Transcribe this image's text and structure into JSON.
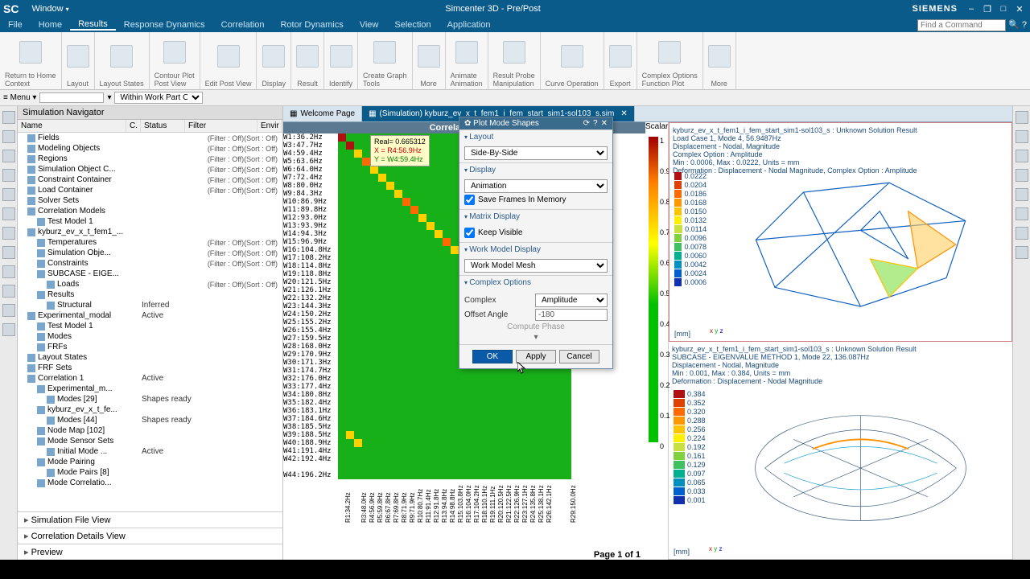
{
  "titlebar": {
    "app_short": "SC",
    "window_menu": "Window",
    "title": "Simcenter 3D - Pre/Post",
    "brand": "SIEMENS"
  },
  "menubar": {
    "items": [
      "File",
      "Home",
      "Results",
      "Response Dynamics",
      "Correlation",
      "Rotor Dynamics",
      "View",
      "Selection",
      "Application"
    ],
    "active_index": 2,
    "search_placeholder": "Find a Command"
  },
  "ribbon": {
    "groups": [
      {
        "label": "Return to Home",
        "sub": "Context"
      },
      {
        "label": "Layout"
      },
      {
        "label": "Layout States"
      },
      {
        "label": "Contour Plot",
        "sub": "Post View"
      },
      {
        "label": "Edit Post View"
      },
      {
        "label": "Display"
      },
      {
        "label": "Result"
      },
      {
        "label": "Identify"
      },
      {
        "label": "Create Graph",
        "sub": "Tools"
      },
      {
        "label": "More"
      },
      {
        "label": "Animate",
        "sub": "Animation"
      },
      {
        "label": "Result Probe",
        "sub": "Manipulation"
      },
      {
        "label": "Curve Operation"
      },
      {
        "label": "Export"
      },
      {
        "label": "Complex Options",
        "sub": "Function Plot"
      },
      {
        "label": "More"
      }
    ]
  },
  "context_row": {
    "menu_label": "Menu",
    "filter_label": "Within Work Part Only"
  },
  "nav": {
    "title": "Simulation Navigator",
    "cols": [
      "Name",
      "C.",
      "Status",
      "Filter",
      "Envir"
    ],
    "rows": [
      {
        "indent": 1,
        "name": "Fields",
        "filter": "(Filter : Off)(Sort : Off)"
      },
      {
        "indent": 1,
        "name": "Modeling Objects",
        "filter": "(Filter : Off)(Sort : Off)"
      },
      {
        "indent": 1,
        "name": "Regions",
        "filter": "(Filter : Off)(Sort : Off)"
      },
      {
        "indent": 1,
        "name": "Simulation Object C...",
        "filter": "(Filter : Off)(Sort : Off)"
      },
      {
        "indent": 1,
        "name": "Constraint Container",
        "filter": "(Filter : Off)(Sort : Off)"
      },
      {
        "indent": 1,
        "name": "Load Container",
        "filter": "(Filter : Off)(Sort : Off)"
      },
      {
        "indent": 1,
        "name": "Solver Sets"
      },
      {
        "indent": 1,
        "name": "Correlation Models"
      },
      {
        "indent": 2,
        "name": "Test Model 1"
      },
      {
        "indent": 1,
        "name": "kyburz_ev_x_t_fem1_..."
      },
      {
        "indent": 2,
        "name": "Temperatures",
        "filter": "(Filter : Off)(Sort : Off)"
      },
      {
        "indent": 2,
        "name": "Simulation Obje...",
        "filter": "(Filter : Off)(Sort : Off)"
      },
      {
        "indent": 2,
        "name": "Constraints",
        "filter": "(Filter : Off)(Sort : Off)"
      },
      {
        "indent": 2,
        "name": "SUBCASE - EIGE..."
      },
      {
        "indent": 3,
        "name": "Loads",
        "filter": "(Filter : Off)(Sort : Off)"
      },
      {
        "indent": 2,
        "name": "Results"
      },
      {
        "indent": 3,
        "name": "Structural",
        "status": "Inferred"
      },
      {
        "indent": 1,
        "name": "Experimental_modal",
        "status": "Active"
      },
      {
        "indent": 2,
        "name": "Test Model 1"
      },
      {
        "indent": 2,
        "name": "Modes"
      },
      {
        "indent": 2,
        "name": "FRFs"
      },
      {
        "indent": 1,
        "name": "Layout States"
      },
      {
        "indent": 1,
        "name": "FRF Sets"
      },
      {
        "indent": 1,
        "name": "Correlation 1",
        "status": "Active"
      },
      {
        "indent": 2,
        "name": "Experimental_m..."
      },
      {
        "indent": 3,
        "name": "Modes [29]",
        "status": "Shapes ready"
      },
      {
        "indent": 2,
        "name": "kyburz_ev_x_t_fe..."
      },
      {
        "indent": 3,
        "name": "Modes [44]",
        "status": "Shapes ready"
      },
      {
        "indent": 2,
        "name": "Node Map [102]"
      },
      {
        "indent": 2,
        "name": "Mode Sensor Sets"
      },
      {
        "indent": 3,
        "name": "Initial Mode ...",
        "status": "Active"
      },
      {
        "indent": 2,
        "name": "Mode Pairing"
      },
      {
        "indent": 3,
        "name": "Mode Pairs [8]"
      },
      {
        "indent": 2,
        "name": "Mode Correlatio..."
      }
    ],
    "accordions": [
      "Simulation File View",
      "Correlation Details View",
      "Preview"
    ]
  },
  "tabs": {
    "items": [
      {
        "label": "Welcome Page"
      },
      {
        "label": "(Simulation) kyburz_ev_x_t_fem1_i_fem_start_sim1-sol103_s.sim",
        "active": true
      }
    ]
  },
  "mac": {
    "title": "Correlation MAC",
    "tooltip": {
      "real": "Real= 0.665312",
      "x": "X   = R4:56.9Hz",
      "y": "Y   = W4:59.4Hz"
    },
    "row_labels": [
      "W1:36.2Hz",
      "W3:47.7Hz",
      "W4:59.4Hz",
      "W5:63.6Hz",
      "W6:64.0Hz",
      "W7:72.4Hz",
      "W8:80.0Hz",
      "W9:84.3Hz",
      "W10:86.9Hz",
      "W11:89.8Hz",
      "W12:93.0Hz",
      "W13:93.9Hz",
      "W14:94.3Hz",
      "W15:96.9Hz",
      "W16:104.8Hz",
      "W17:108.2Hz",
      "W18:114.8Hz",
      "W19:118.8Hz",
      "W20:121.5Hz",
      "W21:126.1Hz",
      "W22:132.2Hz",
      "W23:144.3Hz",
      "W24:150.2Hz",
      "W25:155.2Hz",
      "W26:155.4Hz",
      "W27:159.5Hz",
      "W28:168.0Hz",
      "W29:170.9Hz",
      "W30:171.3Hz",
      "W31:174.7Hz",
      "W32:176.0Hz",
      "W33:177.4Hz",
      "W34:180.8Hz",
      "W35:182.4Hz",
      "W36:183.1Hz",
      "W37:184.6Hz",
      "W38:185.5Hz",
      "W39:188.5Hz",
      "W40:188.9Hz",
      "W41:191.4Hz",
      "W42:192.4Hz",
      "",
      "W44:196.2Hz"
    ],
    "col_labels": [
      "R1:34.2Hz",
      "",
      "R3:48.0Hz",
      "R4:56.9Hz",
      "R5:59.8Hz",
      "R6:67.8Hz",
      "R7:69.8Hz",
      "R8:71.9Hz",
      "R9:71.9Hz",
      "R10:80.7Hz",
      "R11:91.4Hz",
      "R12:91.8Hz",
      "R13:94.8Hz",
      "R14:98.8Hz",
      "R15:103.8Hz",
      "R16:104.0Hz",
      "R17:104.2Hz",
      "R18:110.1Hz",
      "R19:111.1Hz",
      "R20:120.5Hz",
      "R21:122.5Hz",
      "R22:126.9Hz",
      "R23:127.1Hz",
      "R24:135.8Hz",
      "R25:138.1Hz",
      "R26:142.1Hz",
      "",
      "",
      "R29:150.0Hz"
    ],
    "page_label": "Page 1 of 1",
    "scalar_label": "Scalar",
    "scalar_ticks": [
      1,
      0.9,
      0.8,
      0.7,
      0.6,
      0.5,
      0.4,
      0.3,
      0.2,
      0.1,
      0
    ]
  },
  "chart_data": {
    "type": "heatmap",
    "title": "Correlation MAC",
    "ylabels": [
      "W1:36.2Hz",
      "W3:47.7Hz",
      "W4:59.4Hz",
      "W5:63.6Hz",
      "W6:64.0Hz",
      "W7:72.4Hz",
      "W8:80.0Hz",
      "W9:84.3Hz",
      "W10:86.9Hz",
      "W11:89.8Hz",
      "W12:93.0Hz",
      "W13:93.9Hz",
      "W14:94.3Hz",
      "W15:96.9Hz",
      "W16:104.8Hz",
      "W17:108.2Hz",
      "W18:114.8Hz",
      "W19:118.8Hz",
      "W20:121.5Hz",
      "W21:126.1Hz",
      "W22:132.2Hz",
      "W23:144.3Hz",
      "W24:150.2Hz",
      "W25:155.2Hz",
      "W26:155.4Hz",
      "W27:159.5Hz",
      "W28:168.0Hz",
      "W29:170.9Hz",
      "W30:171.3Hz",
      "W31:174.7Hz",
      "W32:176.0Hz",
      "W33:177.4Hz",
      "W34:180.8Hz",
      "W35:182.4Hz",
      "W36:183.1Hz",
      "W37:184.6Hz",
      "W38:185.5Hz",
      "W39:188.5Hz",
      "W40:188.9Hz",
      "W41:191.4Hz",
      "W42:192.4Hz",
      "W44:196.2Hz"
    ],
    "xlabels": [
      "R1:34.2Hz",
      "R3:48.0Hz",
      "R4:56.9Hz",
      "R5:59.8Hz",
      "R6:67.8Hz",
      "R7:69.8Hz",
      "R8:71.9Hz",
      "R9:71.9Hz",
      "R10:80.7Hz",
      "R11:91.4Hz",
      "R12:91.8Hz",
      "R13:94.8Hz",
      "R14:98.8Hz",
      "R15:103.8Hz",
      "R16:104.0Hz",
      "R17:104.2Hz",
      "R18:110.1Hz",
      "R19:111.1Hz",
      "R20:120.5Hz",
      "R21:122.5Hz",
      "R22:126.9Hz",
      "R23:127.1Hz",
      "R24:135.8Hz",
      "R25:138.1Hz",
      "R26:142.1Hz",
      "R29:150.0Hz"
    ],
    "colorscale": [
      [
        0,
        "#00b000"
      ],
      [
        0.4,
        "#00b000"
      ],
      [
        0.5,
        "#a0d000"
      ],
      [
        0.6,
        "#ffff00"
      ],
      [
        0.7,
        "#ffb000"
      ],
      [
        0.85,
        "#ff5000"
      ],
      [
        1,
        "#a00000"
      ]
    ],
    "diag_high_values": [
      [
        0,
        0,
        0.9
      ],
      [
        1,
        1,
        0.85
      ],
      [
        2,
        2,
        0.67
      ],
      [
        3,
        3,
        0.75
      ],
      [
        4,
        4,
        0.6
      ],
      [
        5,
        5,
        0.55
      ],
      [
        8,
        8,
        0.7
      ],
      [
        10,
        10,
        0.65
      ],
      [
        12,
        12,
        0.6
      ],
      [
        37,
        1,
        0.6
      ],
      [
        38,
        2,
        0.55
      ]
    ],
    "color_range": [
      0,
      1
    ],
    "note": "Most off-diagonal cells ≈0 (green); diagonal shows elevated MAC values (yellow→red)."
  },
  "dialog": {
    "title": "Plot Mode Shapes",
    "sections": {
      "layout": {
        "label": "Layout",
        "value": "Side-By-Side"
      },
      "display": {
        "label": "Display",
        "value": "Animation",
        "save_frames": "Save Frames In Memory",
        "save_checked": true
      },
      "matrix": {
        "label": "Matrix Display",
        "keep_visible": "Keep Visible",
        "keep_checked": true
      },
      "work_model": {
        "label": "Work Model Display",
        "value": "Work Model Mesh"
      },
      "complex": {
        "label": "Complex Options",
        "complex_label": "Complex",
        "complex_value": "Amplitude",
        "offset_label": "Offset Angle",
        "offset_value": "-180",
        "compute": "Compute Phase"
      }
    },
    "buttons": {
      "ok": "OK",
      "apply": "Apply",
      "cancel": "Cancel"
    }
  },
  "plots": {
    "top": {
      "lines": [
        "kyburz_ev_x_t_fem1_i_fem_start_sim1-sol103_s : Unknown Solution Result",
        "Load Case 1, Mode 4, 56.9487Hz",
        "Displacement - Nodal, Magnitude",
        "Complex Option : Amplitude",
        "Min : 0.0006, Max : 0.0222, Units = mm",
        "Deformation : Displacement - Nodal Magnitude, Complex Option : Amplitude"
      ],
      "legend": [
        "0.0222",
        "0.0204",
        "0.0186",
        "0.0168",
        "0.0150",
        "0.0132",
        "0.0114",
        "0.0096",
        "0.0078",
        "0.0060",
        "0.0042",
        "0.0024",
        "0.0006"
      ],
      "unit": "[mm]"
    },
    "bottom": {
      "lines": [
        "kyburz_ev_x_t_fem1_i_fem_start_sim1-sol103_s : Unknown Solution Result",
        "SUBCASE - EIGENVALUE METHOD 1, Mode 22, 136.087Hz",
        "Displacement - Nodal, Magnitude",
        "Min : 0.001, Max : 0.384, Units = mm",
        "Deformation : Displacement - Nodal Magnitude"
      ],
      "legend": [
        "0.384",
        "0.352",
        "0.320",
        "0.288",
        "0.256",
        "0.224",
        "0.192",
        "0.161",
        "0.129",
        "0.097",
        "0.065",
        "0.033",
        "0.001"
      ],
      "unit": "[mm]"
    }
  }
}
